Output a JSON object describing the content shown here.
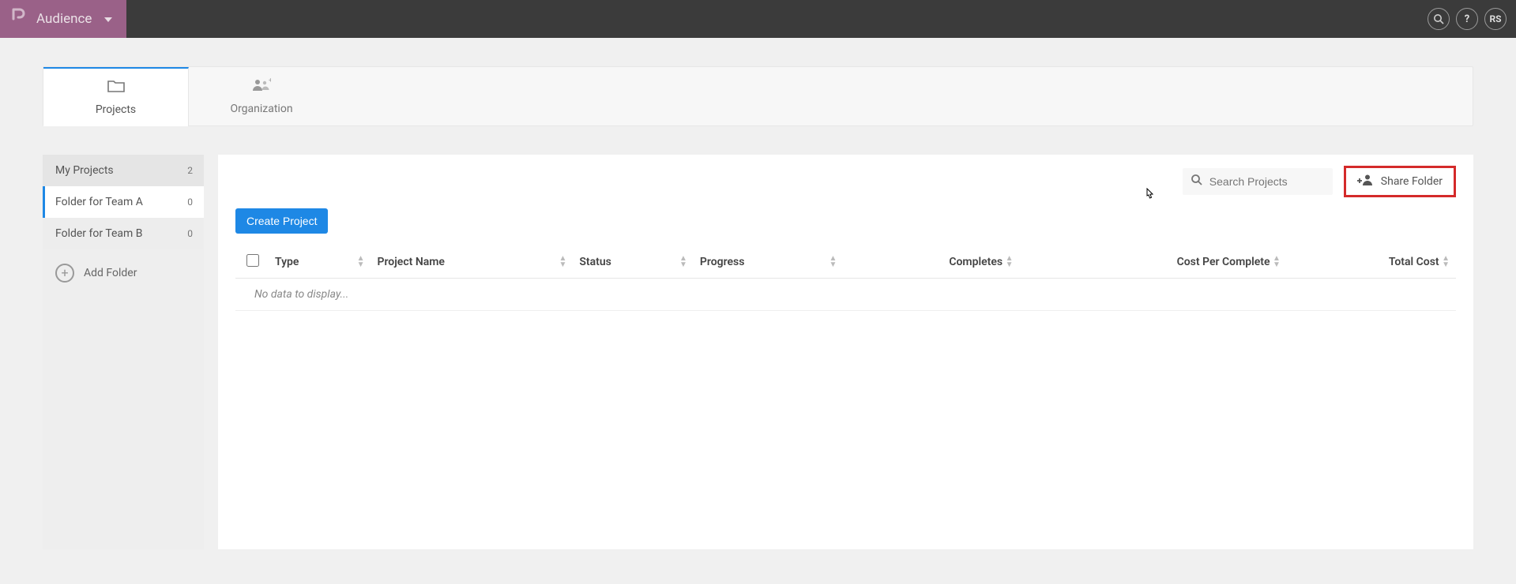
{
  "header": {
    "app_title": "Audience",
    "user_initials": "RS"
  },
  "tabs": [
    {
      "label": "Projects",
      "icon": "folder",
      "active": true
    },
    {
      "label": "Organization",
      "icon": "org",
      "active": false
    }
  ],
  "sidebar": {
    "items": [
      {
        "label": "My Projects",
        "count": "2",
        "active": false,
        "level": 0
      },
      {
        "label": "Folder for Team A",
        "count": "0",
        "active": true,
        "level": 1
      },
      {
        "label": "Folder for Team B",
        "count": "0",
        "active": false,
        "level": 1
      }
    ],
    "add_folder_label": "Add Folder"
  },
  "toolbar": {
    "search_placeholder": "Search Projects",
    "share_label": "Share Folder",
    "create_label": "Create Project"
  },
  "table": {
    "headers": [
      "Type",
      "Project Name",
      "Status",
      "Progress",
      "Completes",
      "Cost Per Complete",
      "Total Cost"
    ],
    "empty_message": "No data to display..."
  }
}
